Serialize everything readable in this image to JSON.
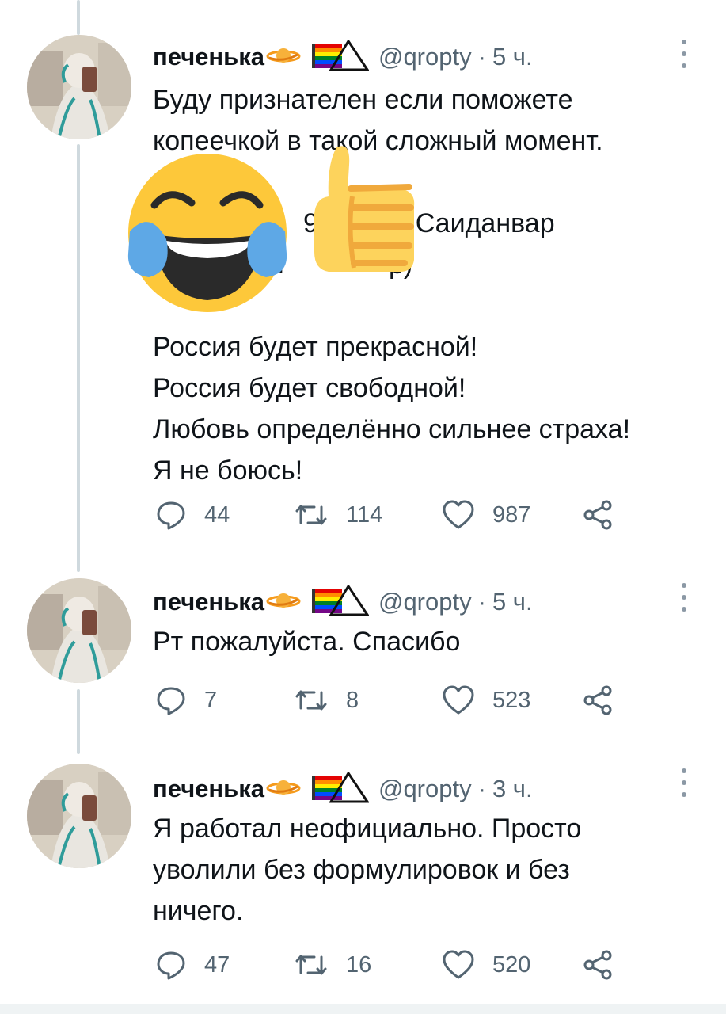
{
  "tweets": [
    {
      "name": "печенька",
      "handle": "@qropty",
      "time": "5 ч.",
      "lines": [
        "Буду признателен если поможете",
        "копеечкой в такой сложный момент.",
        "",
        "9        59 Саиданвар",
        "ч              р)",
        "",
        "Россия будет прекрасной!",
        "Россия будет свободной!",
        "Любовь определённо сильнее страха!",
        "Я не боюсь!"
      ],
      "replies": "44",
      "retweets": "114",
      "likes": "987"
    },
    {
      "name": "печенька",
      "handle": "@qropty",
      "time": "5 ч.",
      "lines": [
        "Рт пожалуйста. Спасибо"
      ],
      "replies": "7",
      "retweets": "8",
      "likes": "523"
    },
    {
      "name": "печенька",
      "handle": "@qropty",
      "time": "3 ч.",
      "lines": [
        "Я работал неофициально. Просто",
        "уволили без формулировок и без",
        "ничего."
      ],
      "replies": "47",
      "retweets": "16",
      "likes": "520"
    }
  ],
  "overlay_stickers": [
    "face-with-tears-of-joy-emoji",
    "thumbs-up-emoji"
  ],
  "colors": {
    "text": "#0f1419",
    "meta": "#536471",
    "thread_line": "#cfd9de"
  }
}
